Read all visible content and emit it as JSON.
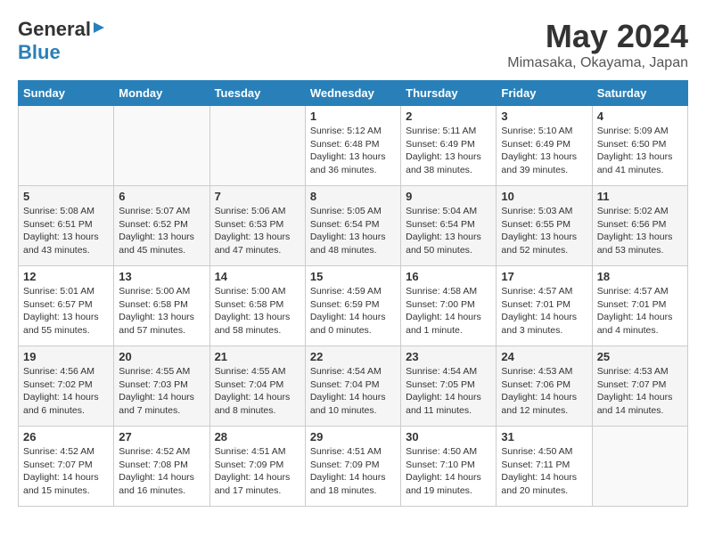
{
  "header": {
    "logo_general": "General",
    "logo_blue": "Blue",
    "month_title": "May 2024",
    "location": "Mimasaka, Okayama, Japan"
  },
  "days_of_week": [
    "Sunday",
    "Monday",
    "Tuesday",
    "Wednesday",
    "Thursday",
    "Friday",
    "Saturday"
  ],
  "weeks": [
    [
      {
        "day": "",
        "sunrise": "",
        "sunset": "",
        "daylight": ""
      },
      {
        "day": "",
        "sunrise": "",
        "sunset": "",
        "daylight": ""
      },
      {
        "day": "",
        "sunrise": "",
        "sunset": "",
        "daylight": ""
      },
      {
        "day": "1",
        "sunrise": "Sunrise: 5:12 AM",
        "sunset": "Sunset: 6:48 PM",
        "daylight": "Daylight: 13 hours and 36 minutes."
      },
      {
        "day": "2",
        "sunrise": "Sunrise: 5:11 AM",
        "sunset": "Sunset: 6:49 PM",
        "daylight": "Daylight: 13 hours and 38 minutes."
      },
      {
        "day": "3",
        "sunrise": "Sunrise: 5:10 AM",
        "sunset": "Sunset: 6:49 PM",
        "daylight": "Daylight: 13 hours and 39 minutes."
      },
      {
        "day": "4",
        "sunrise": "Sunrise: 5:09 AM",
        "sunset": "Sunset: 6:50 PM",
        "daylight": "Daylight: 13 hours and 41 minutes."
      }
    ],
    [
      {
        "day": "5",
        "sunrise": "Sunrise: 5:08 AM",
        "sunset": "Sunset: 6:51 PM",
        "daylight": "Daylight: 13 hours and 43 minutes."
      },
      {
        "day": "6",
        "sunrise": "Sunrise: 5:07 AM",
        "sunset": "Sunset: 6:52 PM",
        "daylight": "Daylight: 13 hours and 45 minutes."
      },
      {
        "day": "7",
        "sunrise": "Sunrise: 5:06 AM",
        "sunset": "Sunset: 6:53 PM",
        "daylight": "Daylight: 13 hours and 47 minutes."
      },
      {
        "day": "8",
        "sunrise": "Sunrise: 5:05 AM",
        "sunset": "Sunset: 6:54 PM",
        "daylight": "Daylight: 13 hours and 48 minutes."
      },
      {
        "day": "9",
        "sunrise": "Sunrise: 5:04 AM",
        "sunset": "Sunset: 6:54 PM",
        "daylight": "Daylight: 13 hours and 50 minutes."
      },
      {
        "day": "10",
        "sunrise": "Sunrise: 5:03 AM",
        "sunset": "Sunset: 6:55 PM",
        "daylight": "Daylight: 13 hours and 52 minutes."
      },
      {
        "day": "11",
        "sunrise": "Sunrise: 5:02 AM",
        "sunset": "Sunset: 6:56 PM",
        "daylight": "Daylight: 13 hours and 53 minutes."
      }
    ],
    [
      {
        "day": "12",
        "sunrise": "Sunrise: 5:01 AM",
        "sunset": "Sunset: 6:57 PM",
        "daylight": "Daylight: 13 hours and 55 minutes."
      },
      {
        "day": "13",
        "sunrise": "Sunrise: 5:00 AM",
        "sunset": "Sunset: 6:58 PM",
        "daylight": "Daylight: 13 hours and 57 minutes."
      },
      {
        "day": "14",
        "sunrise": "Sunrise: 5:00 AM",
        "sunset": "Sunset: 6:58 PM",
        "daylight": "Daylight: 13 hours and 58 minutes."
      },
      {
        "day": "15",
        "sunrise": "Sunrise: 4:59 AM",
        "sunset": "Sunset: 6:59 PM",
        "daylight": "Daylight: 14 hours and 0 minutes."
      },
      {
        "day": "16",
        "sunrise": "Sunrise: 4:58 AM",
        "sunset": "Sunset: 7:00 PM",
        "daylight": "Daylight: 14 hours and 1 minute."
      },
      {
        "day": "17",
        "sunrise": "Sunrise: 4:57 AM",
        "sunset": "Sunset: 7:01 PM",
        "daylight": "Daylight: 14 hours and 3 minutes."
      },
      {
        "day": "18",
        "sunrise": "Sunrise: 4:57 AM",
        "sunset": "Sunset: 7:01 PM",
        "daylight": "Daylight: 14 hours and 4 minutes."
      }
    ],
    [
      {
        "day": "19",
        "sunrise": "Sunrise: 4:56 AM",
        "sunset": "Sunset: 7:02 PM",
        "daylight": "Daylight: 14 hours and 6 minutes."
      },
      {
        "day": "20",
        "sunrise": "Sunrise: 4:55 AM",
        "sunset": "Sunset: 7:03 PM",
        "daylight": "Daylight: 14 hours and 7 minutes."
      },
      {
        "day": "21",
        "sunrise": "Sunrise: 4:55 AM",
        "sunset": "Sunset: 7:04 PM",
        "daylight": "Daylight: 14 hours and 8 minutes."
      },
      {
        "day": "22",
        "sunrise": "Sunrise: 4:54 AM",
        "sunset": "Sunset: 7:04 PM",
        "daylight": "Daylight: 14 hours and 10 minutes."
      },
      {
        "day": "23",
        "sunrise": "Sunrise: 4:54 AM",
        "sunset": "Sunset: 7:05 PM",
        "daylight": "Daylight: 14 hours and 11 minutes."
      },
      {
        "day": "24",
        "sunrise": "Sunrise: 4:53 AM",
        "sunset": "Sunset: 7:06 PM",
        "daylight": "Daylight: 14 hours and 12 minutes."
      },
      {
        "day": "25",
        "sunrise": "Sunrise: 4:53 AM",
        "sunset": "Sunset: 7:07 PM",
        "daylight": "Daylight: 14 hours and 14 minutes."
      }
    ],
    [
      {
        "day": "26",
        "sunrise": "Sunrise: 4:52 AM",
        "sunset": "Sunset: 7:07 PM",
        "daylight": "Daylight: 14 hours and 15 minutes."
      },
      {
        "day": "27",
        "sunrise": "Sunrise: 4:52 AM",
        "sunset": "Sunset: 7:08 PM",
        "daylight": "Daylight: 14 hours and 16 minutes."
      },
      {
        "day": "28",
        "sunrise": "Sunrise: 4:51 AM",
        "sunset": "Sunset: 7:09 PM",
        "daylight": "Daylight: 14 hours and 17 minutes."
      },
      {
        "day": "29",
        "sunrise": "Sunrise: 4:51 AM",
        "sunset": "Sunset: 7:09 PM",
        "daylight": "Daylight: 14 hours and 18 minutes."
      },
      {
        "day": "30",
        "sunrise": "Sunrise: 4:50 AM",
        "sunset": "Sunset: 7:10 PM",
        "daylight": "Daylight: 14 hours and 19 minutes."
      },
      {
        "day": "31",
        "sunrise": "Sunrise: 4:50 AM",
        "sunset": "Sunset: 7:11 PM",
        "daylight": "Daylight: 14 hours and 20 minutes."
      },
      {
        "day": "",
        "sunrise": "",
        "sunset": "",
        "daylight": ""
      }
    ]
  ]
}
